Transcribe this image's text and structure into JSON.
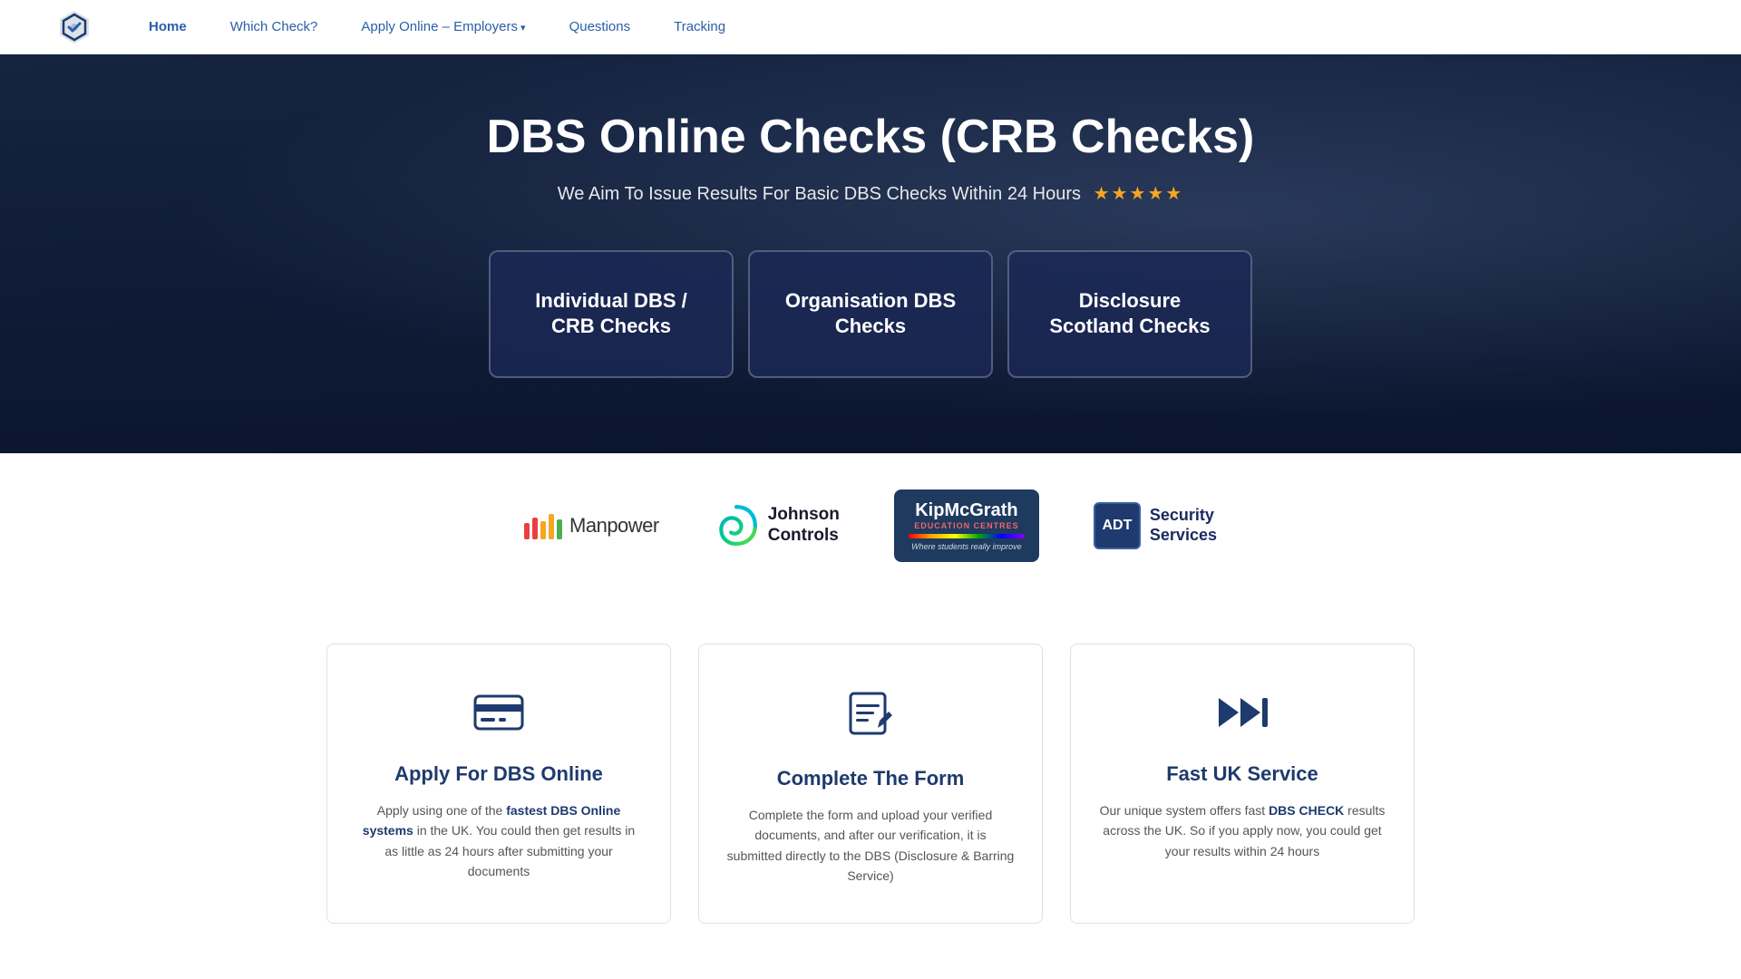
{
  "nav": {
    "links": [
      {
        "label": "Home",
        "active": true,
        "hasArrow": false
      },
      {
        "label": "Which Check?",
        "active": false,
        "hasArrow": false
      },
      {
        "label": "Apply Online – Employers",
        "active": false,
        "hasArrow": true
      },
      {
        "label": "Questions",
        "active": false,
        "hasArrow": false
      },
      {
        "label": "Tracking",
        "active": false,
        "hasArrow": false
      }
    ]
  },
  "hero": {
    "title": "DBS Online Checks (CRB Checks)",
    "subtitle": "We Aim To Issue Results For Basic DBS Checks Within 24 Hours",
    "stars": "★★★★★",
    "cards": [
      {
        "label": "Individual DBS / CRB Checks"
      },
      {
        "label": "Organisation DBS Checks"
      },
      {
        "label": "Disclosure Scotland Checks"
      }
    ]
  },
  "logos": [
    {
      "name": "Manpower",
      "type": "manpower"
    },
    {
      "name": "Johnson Controls",
      "type": "jc"
    },
    {
      "name": "KipMcGrath",
      "type": "kip"
    },
    {
      "name": "ADT Security Services",
      "type": "adt"
    }
  ],
  "features": [
    {
      "icon": "credit-card",
      "title": "Apply For DBS Online",
      "text": "Apply using one of the <strong>fastest DBS Online systems</strong> in the UK. You could then get results in as little as 24 hours after submitting your documents"
    },
    {
      "icon": "edit",
      "title": "Complete The Form",
      "text": "Complete the form and upload your verified documents, and after our verification, it is submitted directly to the DBS (Disclosure & Barring Service)"
    },
    {
      "icon": "fast-forward",
      "title": "Fast UK Service",
      "text": "Our unique system offers fast <strong>DBS CHECK</strong> results across the UK. So if you apply now, you could get your results within 24 hours"
    }
  ]
}
